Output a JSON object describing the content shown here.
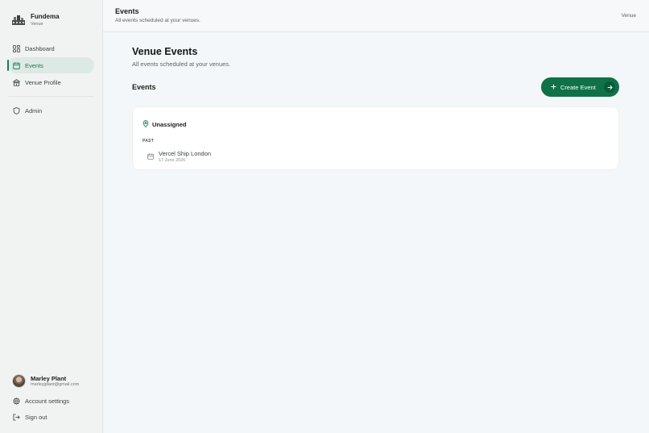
{
  "brand": {
    "name": "Fundema",
    "sub": "Venue"
  },
  "nav": [
    {
      "label": "Dashboard",
      "icon": "grid-icon",
      "active": false
    },
    {
      "label": "Events",
      "icon": "calendar-icon",
      "active": true
    },
    {
      "label": "Venue Profile",
      "icon": "building-icon",
      "active": false
    },
    {
      "label": "Admin",
      "icon": "shield-icon",
      "active": false
    }
  ],
  "user": {
    "name": "Marley Plant",
    "email": "marleyjplant@gmail.com"
  },
  "footer_links": {
    "account_settings": "Account settings",
    "sign_out": "Sign out"
  },
  "topbar": {
    "title": "Events",
    "subtitle": "All events scheduled at your venues.",
    "right": "Venue"
  },
  "page": {
    "title": "Venue Events",
    "subtitle": "All events scheduled at your venues."
  },
  "section": {
    "title": "Events",
    "create_label": "Create Event"
  },
  "group": {
    "name": "Unassigned",
    "label": "PAST",
    "events": [
      {
        "name": "Vercel Ship London",
        "date": "17 June 2026"
      }
    ]
  },
  "colors": {
    "accent": "#0f7148",
    "active_bg": "#dde9e4",
    "background": "#f4f7f9"
  }
}
